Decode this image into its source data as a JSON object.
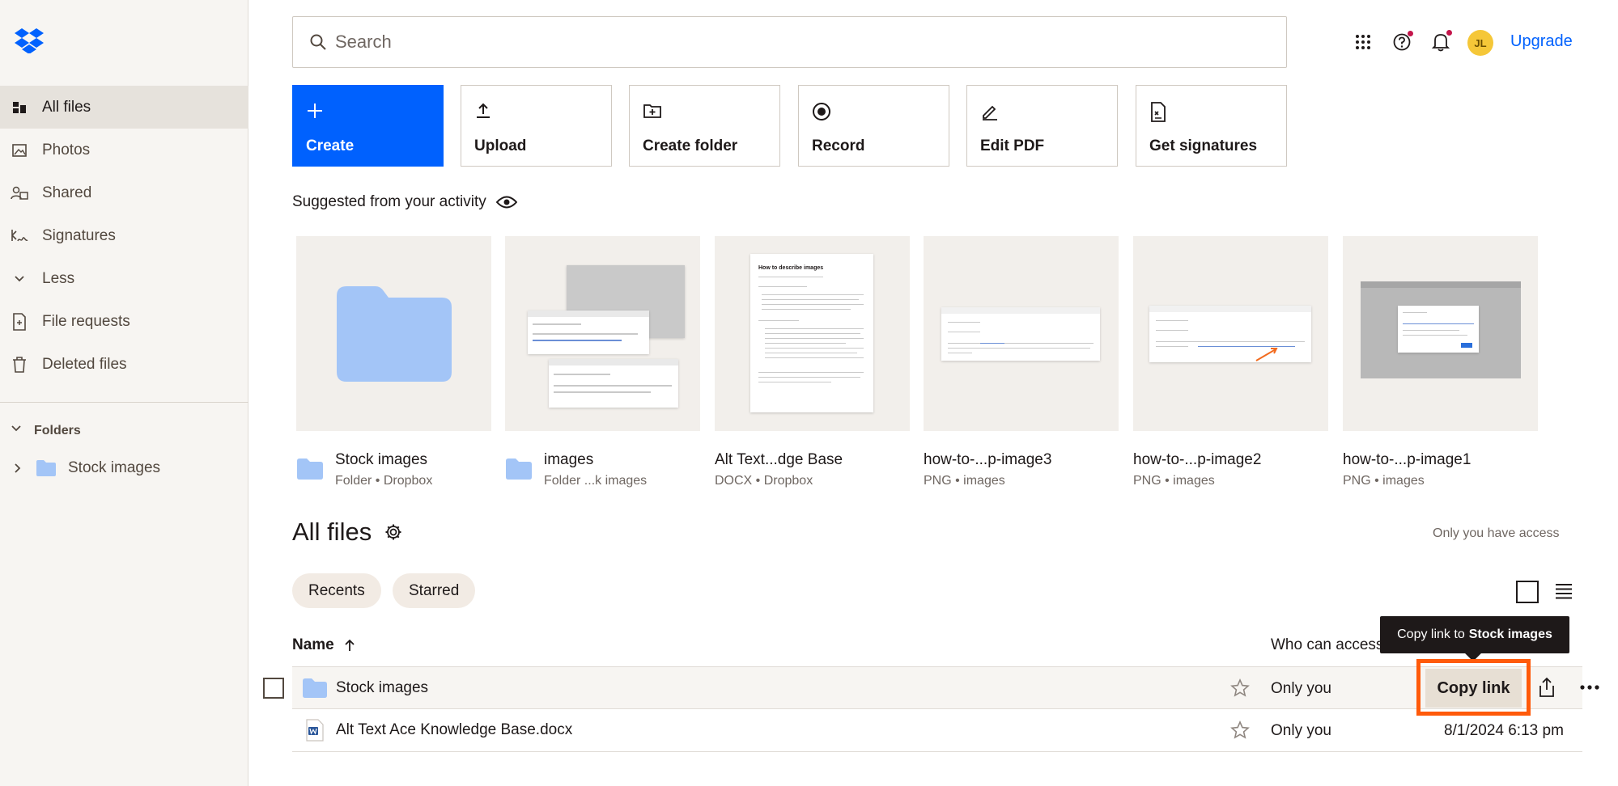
{
  "sidebar": {
    "items": [
      {
        "label": "All files",
        "icon": "files-icon",
        "active": true
      },
      {
        "label": "Photos",
        "icon": "photos-icon"
      },
      {
        "label": "Shared",
        "icon": "shared-icon"
      },
      {
        "label": "Signatures",
        "icon": "signature-icon"
      },
      {
        "label": "Less",
        "icon": "chevron-down-icon"
      },
      {
        "label": "File requests",
        "icon": "file-request-icon"
      },
      {
        "label": "Deleted files",
        "icon": "trash-icon"
      }
    ],
    "folders_header": "Folders",
    "tree": [
      {
        "label": "Stock images"
      }
    ]
  },
  "search": {
    "placeholder": "Search"
  },
  "header": {
    "avatar_initials": "JL",
    "upgrade_label": "Upgrade"
  },
  "actions": [
    {
      "label": "Create",
      "icon": "plus-icon"
    },
    {
      "label": "Upload",
      "icon": "upload-icon"
    },
    {
      "label": "Create folder",
      "icon": "folder-add-icon"
    },
    {
      "label": "Record",
      "icon": "record-icon"
    },
    {
      "label": "Edit PDF",
      "icon": "edit-pdf-icon"
    },
    {
      "label": "Get signatures",
      "icon": "signature-doc-icon"
    }
  ],
  "suggested": {
    "title": "Suggested from your activity",
    "items": [
      {
        "name": "Stock images",
        "sub": "Folder • Dropbox",
        "kind": "folder"
      },
      {
        "name": "images",
        "sub": "Folder ...k images",
        "kind": "folder"
      },
      {
        "name": "Alt Text...dge Base",
        "sub": "DOCX • Dropbox",
        "kind": "docx",
        "doc_title": "How to describe images"
      },
      {
        "name": "how-to-...p-image3",
        "sub": "PNG • images",
        "kind": "png"
      },
      {
        "name": "how-to-...p-image2",
        "sub": "PNG • images",
        "kind": "png"
      },
      {
        "name": "how-to-...p-image1",
        "sub": "PNG • images",
        "kind": "png"
      }
    ]
  },
  "all_files": {
    "title": "All files",
    "access_note": "Only you have access",
    "chips": [
      "Recents",
      "Starred"
    ],
    "columns": {
      "name": "Name",
      "access": "Who can access"
    },
    "rows": [
      {
        "name": "Stock images",
        "kind": "folder",
        "who": "Only you",
        "date": ""
      },
      {
        "name": "Alt Text Ace Knowledge Base.docx",
        "kind": "docx",
        "who": "Only you",
        "date": "8/1/2024 6:13 pm"
      }
    ]
  },
  "tooltip": {
    "prefix": "Copy link to",
    "target": "Stock images"
  },
  "copy_link_label": "Copy link",
  "colors": {
    "accent": "#0061fe",
    "highlight": "#ff5a0a",
    "notification_dot": "#c4154b"
  }
}
